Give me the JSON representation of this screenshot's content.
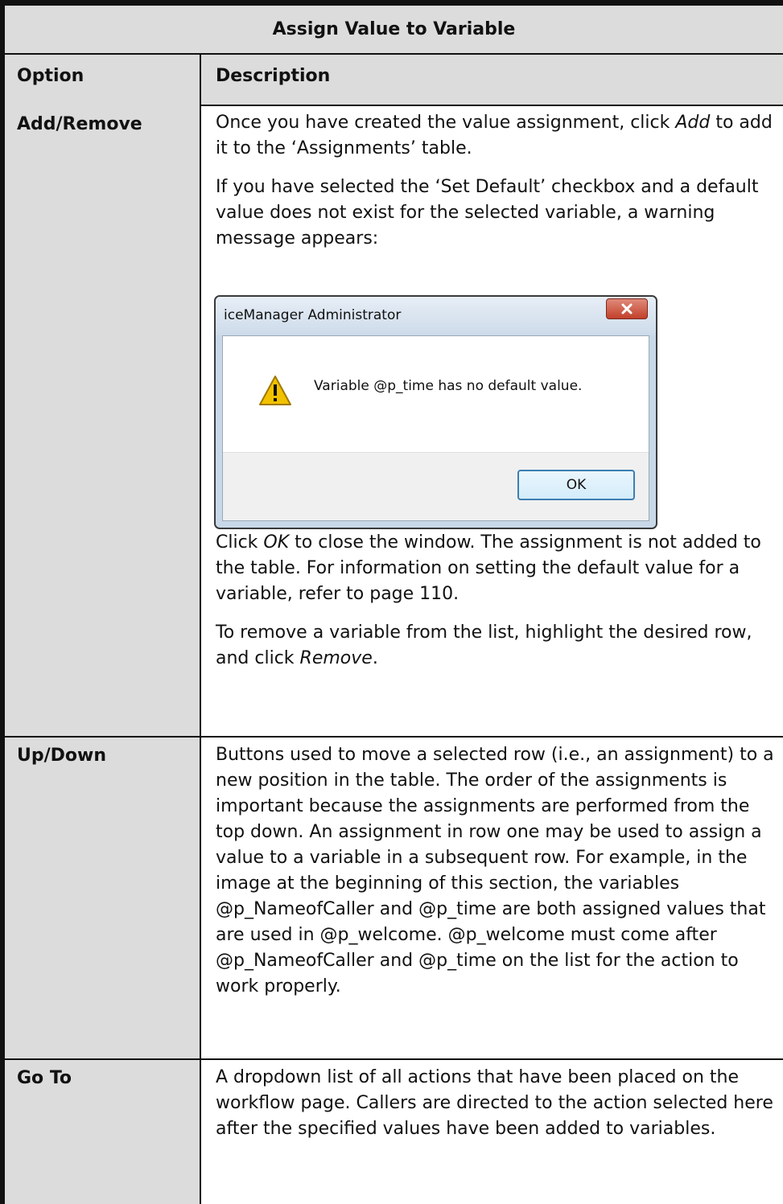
{
  "table": {
    "title": "Assign Value to Variable",
    "header": {
      "option": "Option",
      "description": "Description"
    },
    "rows": [
      {
        "option": "Add/Remove",
        "p1_a": "Once you have created the value assignment, click ",
        "p1_em": "Add",
        "p1_b": " to add it to the ‘Assignments’ table.",
        "p2": "If you have selected the ‘Set Default’ checkbox and a default value does not exist for the selected variable, a warning message appears:",
        "p3_a": "Click ",
        "p3_em": "OK",
        "p3_b": " to close the window. The assignment is not added to the table. For information on setting the default value for a variable, refer to page 110.",
        "p4_a": "To remove a variable from the list, highlight the desired row, and click ",
        "p4_em": "Remove",
        "p4_b": "."
      },
      {
        "option": "Up/Down",
        "text": "Buttons used to move a selected row (i.e., an assignment) to a new position in the table. The order of the assignments is important because the assignments are performed from the top down. An assignment in row one may be used to assign a value to a variable in a subsequent row. For example, in the image at the beginning of this section, the variables @p_NameofCaller and @p_time are both assigned values that are used in @p_welcome. @p_welcome must come after @p_NameofCaller and @p_time on the list for the action to work properly."
      },
      {
        "option": "Go To",
        "text": "A dropdown list of all actions that have been placed on the workflow page. Callers are directed to the action selected here after the specified values have been added to variables."
      }
    ]
  },
  "dialog": {
    "title": "iceManager Administrator",
    "message": "Variable @p_time has no default value.",
    "ok_label": "OK",
    "icon": "warning-icon",
    "close_icon": "close-icon"
  },
  "colors": {
    "header_bg": "#dcdcdc",
    "border": "#111111",
    "close_button": "#c2402a",
    "warning_yellow": "#f2c200"
  }
}
